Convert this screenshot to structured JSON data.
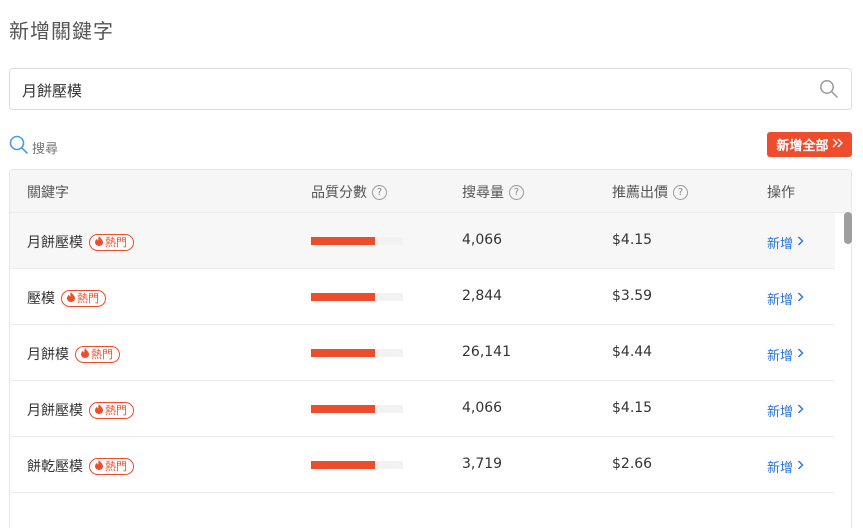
{
  "page": {
    "title": "新增關鍵字"
  },
  "search": {
    "value": "月餅壓模",
    "link_label": "搜尋"
  },
  "toolbar": {
    "add_all_label": "新增全部"
  },
  "table": {
    "headers": {
      "keyword": "關鍵字",
      "quality": "品質分數",
      "volume": "搜尋量",
      "bid": "推薦出價",
      "action": "操作"
    },
    "hot_label": "熱門",
    "action_label": "新增",
    "rows": [
      {
        "keyword": "月餅壓模",
        "quality_pct": 70,
        "volume": "4,066",
        "bid": "$4.15"
      },
      {
        "keyword": "壓模",
        "quality_pct": 70,
        "volume": "2,844",
        "bid": "$3.59"
      },
      {
        "keyword": "月餅模",
        "quality_pct": 70,
        "volume": "26,141",
        "bid": "$4.44"
      },
      {
        "keyword": "月餅壓模",
        "quality_pct": 70,
        "volume": "4,066",
        "bid": "$4.15"
      },
      {
        "keyword": "餅乾壓模",
        "quality_pct": 70,
        "volume": "3,719",
        "bid": "$2.66"
      }
    ]
  },
  "colors": {
    "accent": "#ee4d2d",
    "link": "#2673dd"
  },
  "icons": {
    "search": "search-icon",
    "hot": "flame-icon",
    "chevron": "chevron-right-icon",
    "help": "question-circle-icon"
  }
}
